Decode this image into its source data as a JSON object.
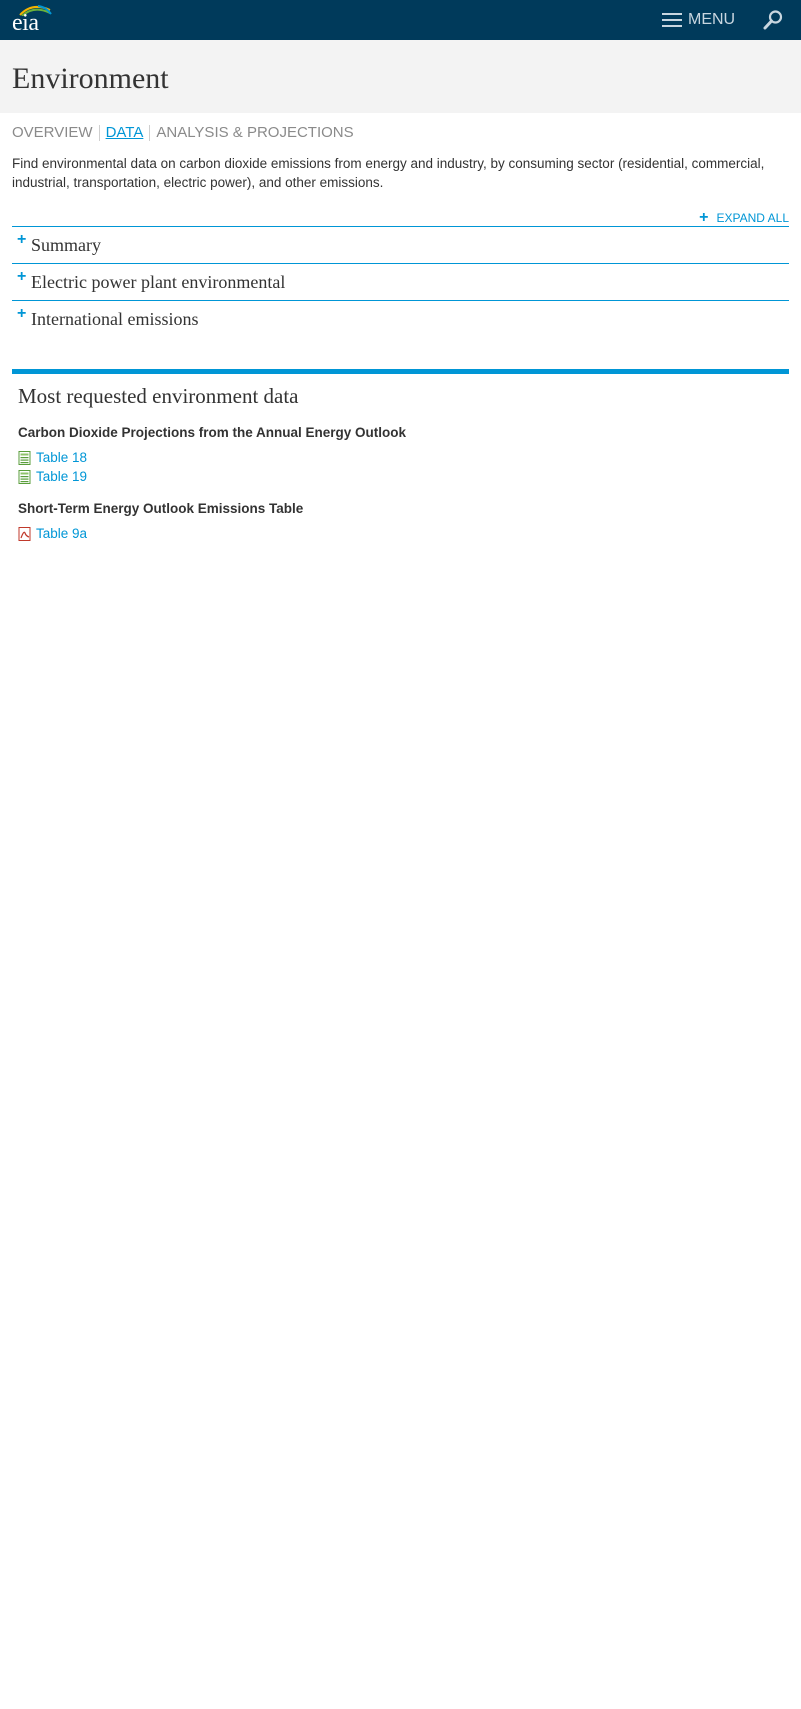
{
  "header": {
    "logo_text": "eia",
    "menu_label": "MENU"
  },
  "page": {
    "title": "Environment"
  },
  "tabs": [
    {
      "label": "OVERVIEW",
      "active": false
    },
    {
      "label": "DATA",
      "active": true
    },
    {
      "label": "ANALYSIS & PROJECTIONS",
      "active": false
    }
  ],
  "intro": "Find environmental data on carbon dioxide emissions from energy and industry, by consuming sector (residential, commercial, industrial, transportation, electric power), and other emissions.",
  "expand_all_label": "EXPAND ALL",
  "accordion": [
    {
      "label": "Summary"
    },
    {
      "label": "Electric power plant environmental"
    },
    {
      "label": "International emissions"
    }
  ],
  "most_requested": {
    "title": "Most requested environment data",
    "groups": [
      {
        "title": "Carbon Dioxide Projections from the Annual Energy Outlook",
        "links": [
          {
            "label": "Table 18",
            "icon": "excel-file-icon"
          },
          {
            "label": "Table 19",
            "icon": "excel-file-icon"
          }
        ]
      },
      {
        "title": "Short-Term Energy Outlook Emissions Table",
        "links": [
          {
            "label": "Table 9a",
            "icon": "pdf-file-icon"
          }
        ]
      }
    ]
  },
  "colors": {
    "header_bg": "#003a5b",
    "accent": "#0096d6",
    "page_head_bg": "#f3f3f3"
  }
}
